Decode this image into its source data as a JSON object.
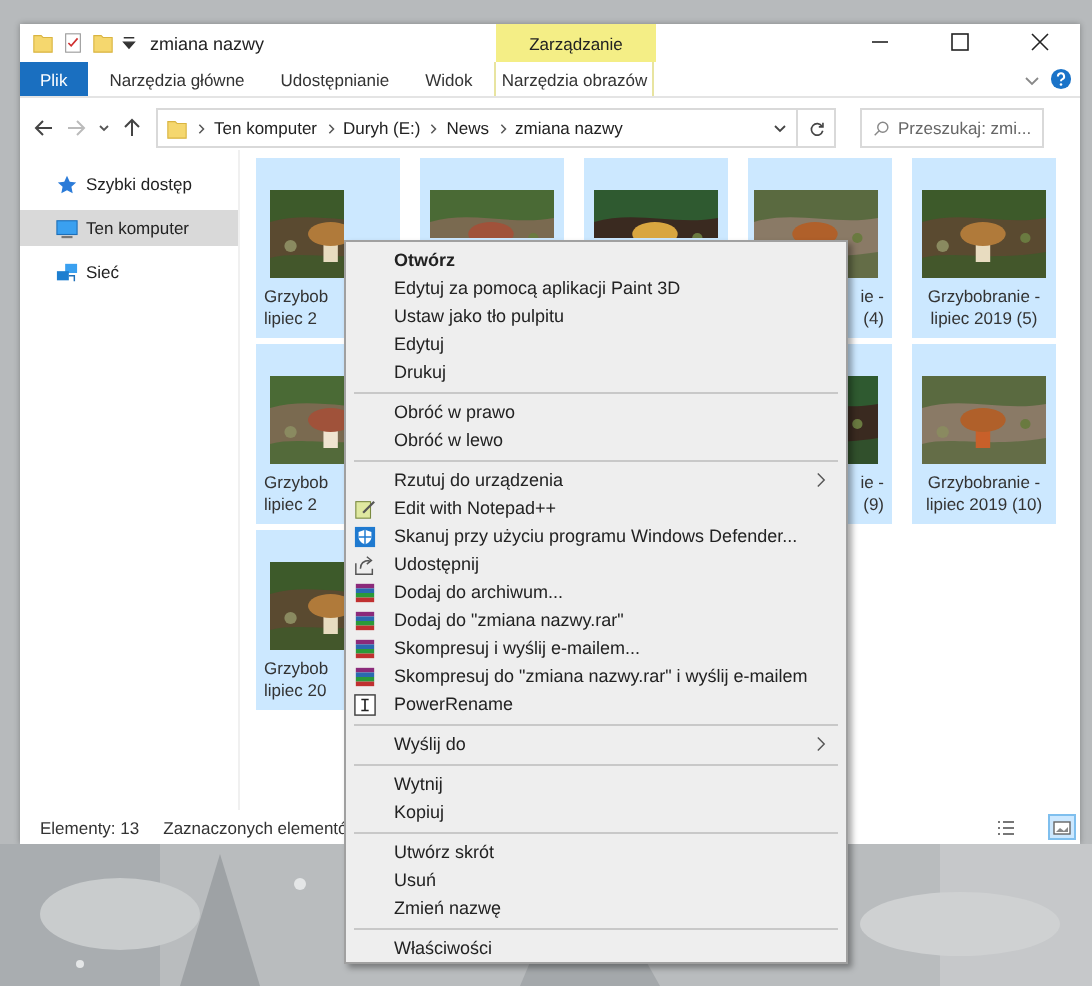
{
  "window": {
    "title": "zmiana nazwy",
    "contextual_group": "Zarządzanie"
  },
  "ribbon_tabs": [
    {
      "label": "Plik",
      "kind": "file"
    },
    {
      "label": "Narzędzia główne",
      "kind": "tab"
    },
    {
      "label": "Udostępnianie",
      "kind": "tab"
    },
    {
      "label": "Widok",
      "kind": "tab"
    },
    {
      "label": "Narzędzia obrazów",
      "kind": "contextual"
    }
  ],
  "address": {
    "path": [
      "Ten komputer",
      "Duryh (E:)",
      "News",
      "zmiana nazwy"
    ]
  },
  "search": {
    "placeholder": "Przeszukaj: zmi..."
  },
  "sidebar": {
    "items": [
      {
        "label": "Szybki dostęp",
        "selected": false
      },
      {
        "label": "Ten komputer",
        "selected": true
      },
      {
        "label": "Sieć",
        "selected": false
      }
    ]
  },
  "files": [
    {
      "kind": "cut_right",
      "selected": true,
      "lines": [
        "Grzybob",
        "lipiec 2"
      ]
    },
    {
      "kind": "covered",
      "selected": true
    },
    {
      "kind": "covered",
      "selected": true
    },
    {
      "kind": "cut_left",
      "selected": true,
      "lines": [
        "ie -",
        "(4)"
      ]
    },
    {
      "kind": "full",
      "selected": true,
      "lines": [
        "Grzybobranie -",
        "lipiec 2019 (5)"
      ]
    },
    {
      "kind": "cut_right",
      "selected": true,
      "lines": [
        "Grzybob",
        "lipiec 2"
      ]
    },
    {
      "kind": "cut_left",
      "selected": true,
      "lines": [
        "ie -",
        "(9)"
      ]
    },
    {
      "kind": "full",
      "selected": true,
      "lines": [
        "Grzybobranie -",
        "lipiec 2019 (10)"
      ]
    },
    {
      "kind": "cut_right",
      "selected": true,
      "lines": [
        "Grzybob",
        "lipiec 20"
      ]
    }
  ],
  "status_bar": {
    "count": "Elementy: 13",
    "selection": "Zaznaczonych elementó",
    "views": [
      {
        "kind": "details",
        "selected": false
      },
      {
        "kind": "large_icons",
        "selected": true
      }
    ]
  },
  "context_menu": {
    "items": [
      {
        "kind": "item",
        "label": "Otwórz",
        "bold": true
      },
      {
        "kind": "item",
        "label": "Edytuj za pomocą aplikacji Paint 3D"
      },
      {
        "kind": "item",
        "label": "Ustaw jako tło pulpitu"
      },
      {
        "kind": "item",
        "label": "Edytuj"
      },
      {
        "kind": "item",
        "label": "Drukuj"
      },
      {
        "kind": "separator"
      },
      {
        "kind": "item",
        "label": "Obróć w prawo"
      },
      {
        "kind": "item",
        "label": "Obróć w lewo"
      },
      {
        "kind": "separator"
      },
      {
        "kind": "item",
        "label": "Rzutuj do urządzenia",
        "submenu": true
      },
      {
        "kind": "notepad",
        "label": "Edit with Notepad++"
      },
      {
        "kind": "defender",
        "label": "Skanuj przy użyciu programu Windows Defender..."
      },
      {
        "kind": "share",
        "label": "Udostępnij"
      },
      {
        "kind": "archive",
        "label": "Dodaj do archiwum..."
      },
      {
        "kind": "archive",
        "label": "Dodaj do \"zmiana nazwy.rar\""
      },
      {
        "kind": "archive",
        "label": "Skompresuj i wyślij e-mailem..."
      },
      {
        "kind": "archive",
        "label": "Skompresuj do \"zmiana nazwy.rar\" i wyślij e-mailem"
      },
      {
        "kind": "rename",
        "label": "PowerRename"
      },
      {
        "kind": "separator"
      },
      {
        "kind": "item",
        "label": "Wyślij do",
        "submenu": true
      },
      {
        "kind": "separator"
      },
      {
        "kind": "item",
        "label": "Wytnij"
      },
      {
        "kind": "item",
        "label": "Kopiuj"
      },
      {
        "kind": "separator"
      },
      {
        "kind": "item",
        "label": "Utwórz skrót"
      },
      {
        "kind": "item",
        "label": "Usuń"
      },
      {
        "kind": "item",
        "label": "Zmień nazwę"
      },
      {
        "kind": "separator"
      },
      {
        "kind": "item",
        "label": "Właściwości"
      }
    ]
  }
}
